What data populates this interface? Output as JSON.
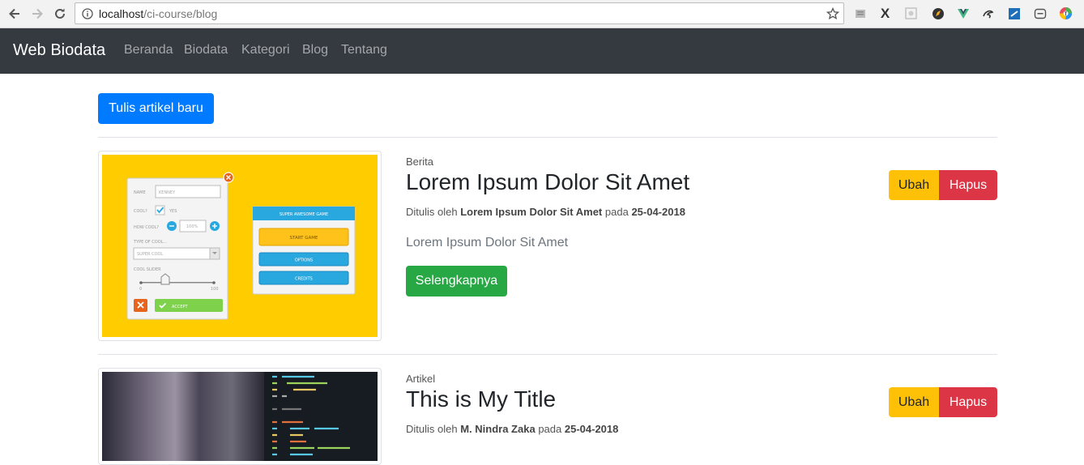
{
  "browser": {
    "url_host": "localhost",
    "url_path": "/ci-course/blog"
  },
  "navbar": {
    "brand": "Web Biodata",
    "links": [
      "Beranda",
      "Biodata",
      "Kategori",
      "Blog",
      "Tentang"
    ]
  },
  "actions": {
    "new_article": "Tulis artikel baru"
  },
  "posts": [
    {
      "category": "Berita",
      "title": "Lorem Ipsum Dolor Sit Amet",
      "written_by": "Ditulis oleh",
      "author": "Lorem Ipsum Dolor Sit Amet",
      "on": "pada",
      "date": "25-04-2018",
      "excerpt": "Lorem Ipsum Dolor Sit Amet",
      "read_more": "Selengkapnya",
      "edit": "Ubah",
      "delete": "Hapus",
      "image": {
        "label_name": "NAME",
        "name_value": "KENNEY",
        "label_cool": "COOL?",
        "cool_yes": "YES",
        "label_how_cool": "HOW COOL?",
        "how_cool_value": "100%",
        "label_type": "TYPE OF COOL...",
        "type_value": "SUPER COOL",
        "label_slider": "COOL SLIDER",
        "slider_min": "0",
        "slider_max": "100",
        "accept": "ACCEPT",
        "game_title": "SUPER AWESOME GAME",
        "start": "START GAME",
        "options": "OPTIONS",
        "credits": "CREDITS"
      }
    },
    {
      "category": "Artikel",
      "title": "This is My Title",
      "written_by": "Ditulis oleh",
      "author": "M. Nindra Zaka",
      "on": "pada",
      "date": "25-04-2018",
      "edit": "Ubah",
      "delete": "Hapus"
    }
  ],
  "colors": {
    "primary": "#007bff",
    "success": "#28a745",
    "warning": "#ffc107",
    "danger": "#dc3545",
    "navbar": "#343a40",
    "thumb_bg": "#ffcc00"
  }
}
